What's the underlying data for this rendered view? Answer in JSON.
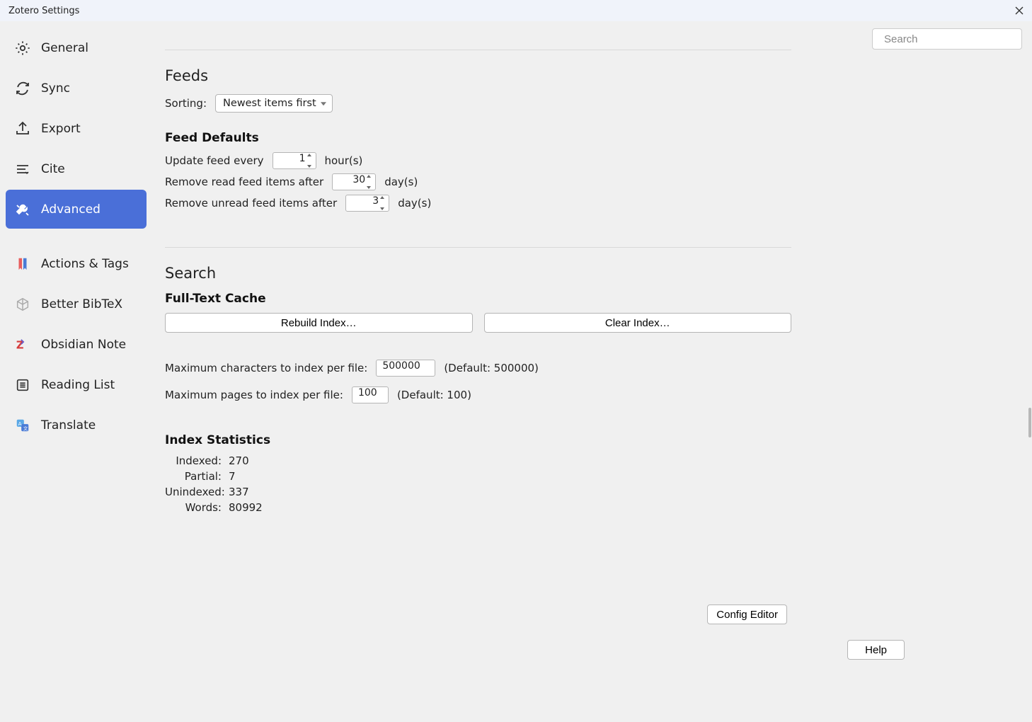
{
  "window": {
    "title": "Zotero Settings"
  },
  "search": {
    "placeholder": "Search"
  },
  "sidebar": {
    "items": [
      {
        "label": "General"
      },
      {
        "label": "Sync"
      },
      {
        "label": "Export"
      },
      {
        "label": "Cite"
      },
      {
        "label": "Advanced"
      },
      {
        "label": "Actions & Tags"
      },
      {
        "label": "Better BibTeX"
      },
      {
        "label": "Obsidian Note"
      },
      {
        "label": "Reading List"
      },
      {
        "label": "Translate"
      }
    ]
  },
  "feeds": {
    "heading": "Feeds",
    "sorting_label": "Sorting:",
    "sorting_value": "Newest items first",
    "defaults_heading": "Feed Defaults",
    "update_label": "Update feed every",
    "update_value": "1",
    "update_unit": "hour(s)",
    "remove_read_label": "Remove read feed items after",
    "remove_read_value": "30",
    "remove_read_unit": "day(s)",
    "remove_unread_label": "Remove unread feed items after",
    "remove_unread_value": "3",
    "remove_unread_unit": "day(s)"
  },
  "search_section": {
    "heading": "Search",
    "fulltext_heading": "Full-Text Cache",
    "rebuild_label": "Rebuild Index…",
    "clear_label": "Clear Index…",
    "max_chars_label": "Maximum characters to index per file:",
    "max_chars_value": "500000",
    "max_chars_default": "(Default: 500000)",
    "max_pages_label": "Maximum pages to index per file:",
    "max_pages_value": "100",
    "max_pages_default": "(Default: 100)",
    "stats_heading": "Index Statistics",
    "stats": {
      "indexed_label": "Indexed:",
      "indexed_value": "270",
      "partial_label": "Partial:",
      "partial_value": "7",
      "unindexed_label": "Unindexed:",
      "unindexed_value": "337",
      "words_label": "Words:",
      "words_value": "80992"
    }
  },
  "buttons": {
    "config_editor": "Config Editor",
    "help": "Help"
  }
}
